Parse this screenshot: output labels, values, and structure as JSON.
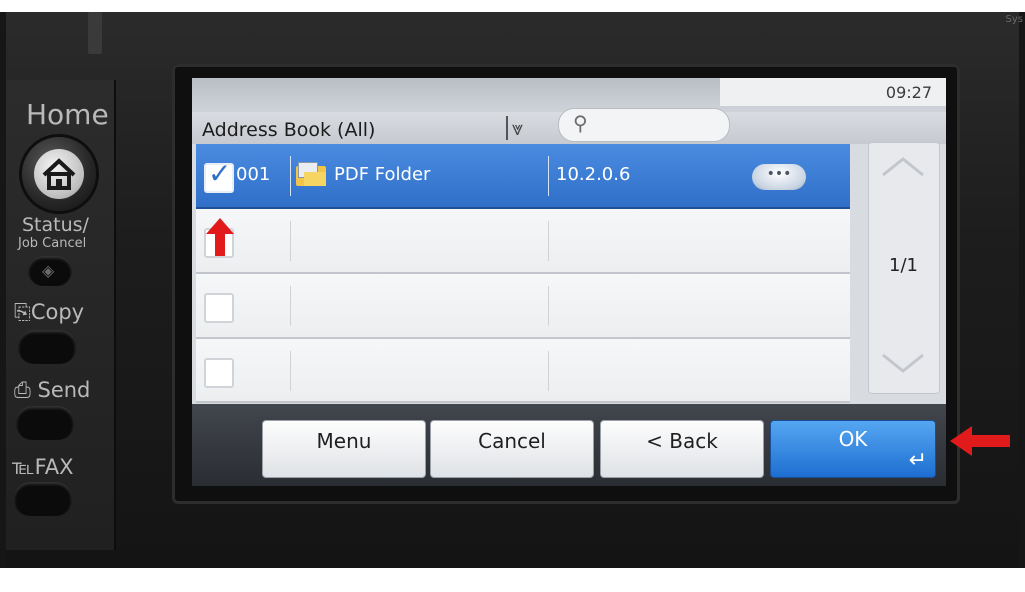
{
  "device": {
    "home_label": "Home",
    "status_label": "Status/",
    "job_cancel_label": "Job Cancel",
    "copy_label": "Copy",
    "send_label": "Send",
    "fax_label": "FAX",
    "corner_text": "Sys"
  },
  "screen": {
    "clock": "09:27",
    "address_book_label": "Address Book (All)",
    "search_placeholder": ""
  },
  "list": {
    "rows": [
      {
        "selected": true,
        "checked": true,
        "number": "001",
        "name": "PDF Folder",
        "host": "10.2.0.6",
        "icon": "folder-icon"
      },
      {
        "selected": false,
        "checked": false,
        "number": "",
        "name": "",
        "host": ""
      },
      {
        "selected": false,
        "checked": false,
        "number": "",
        "name": "",
        "host": ""
      }
    ]
  },
  "pager": {
    "page": "1/1"
  },
  "footer": {
    "menu": "Menu",
    "cancel": "Cancel",
    "back": "< Back",
    "ok": "OK"
  },
  "colors": {
    "selected_row": "#2f6fc8",
    "ok_button": "#1e6ed1",
    "annotation_arrow": "#e11b1b"
  }
}
